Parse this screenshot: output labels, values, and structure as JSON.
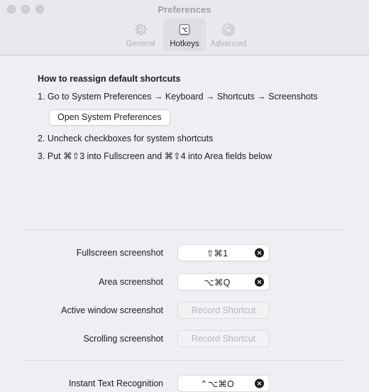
{
  "window": {
    "title": "Preferences",
    "traffic_lights": [
      "close-button",
      "minimize-button",
      "zoom-button"
    ]
  },
  "toolbar": {
    "tabs": [
      {
        "label": "General",
        "icon": "gear-icon",
        "selected": false
      },
      {
        "label": "Hotkeys",
        "icon": "keyboard-key-icon",
        "selected": true
      },
      {
        "label": "Advanced",
        "icon": "spiral-icon",
        "selected": false
      }
    ]
  },
  "howto": {
    "title": "How to reassign default shortcuts",
    "step1": "1. Go to System Preferences → Keyboard → Shortcuts → Screenshots",
    "open_prefs_button": "Open System Preferences",
    "step2": "2. Uncheck checkboxes for system shortcuts",
    "step3": "3. Put ⌘⇧3 into Fullscreen and ⌘⇧4 into Area fields below"
  },
  "shortcuts": {
    "placeholder": "Record Shortcut",
    "rows": [
      {
        "label": "Fullscreen screenshot",
        "value": "⇧⌘1",
        "filled": true
      },
      {
        "label": "Area screenshot",
        "value": "⌥⌘Q",
        "filled": true
      },
      {
        "label": "Active window screenshot",
        "value": "",
        "filled": false
      },
      {
        "label": "Scrolling screenshot",
        "value": "",
        "filled": false
      },
      {
        "label": "Instant Text Recognition",
        "value": "⌃⌥⌘O",
        "filled": true
      }
    ]
  },
  "colors": {
    "window_bg": "#eeeff2",
    "toolbar_bg": "#e8e9ec",
    "selected_tab_bg": "#dedfe3",
    "text": "#1c1c1e",
    "muted_text": "#b2b3b8",
    "field_bg": "#ffffff",
    "clear_button": "#1c1c1e",
    "divider": "#dbdce0"
  }
}
